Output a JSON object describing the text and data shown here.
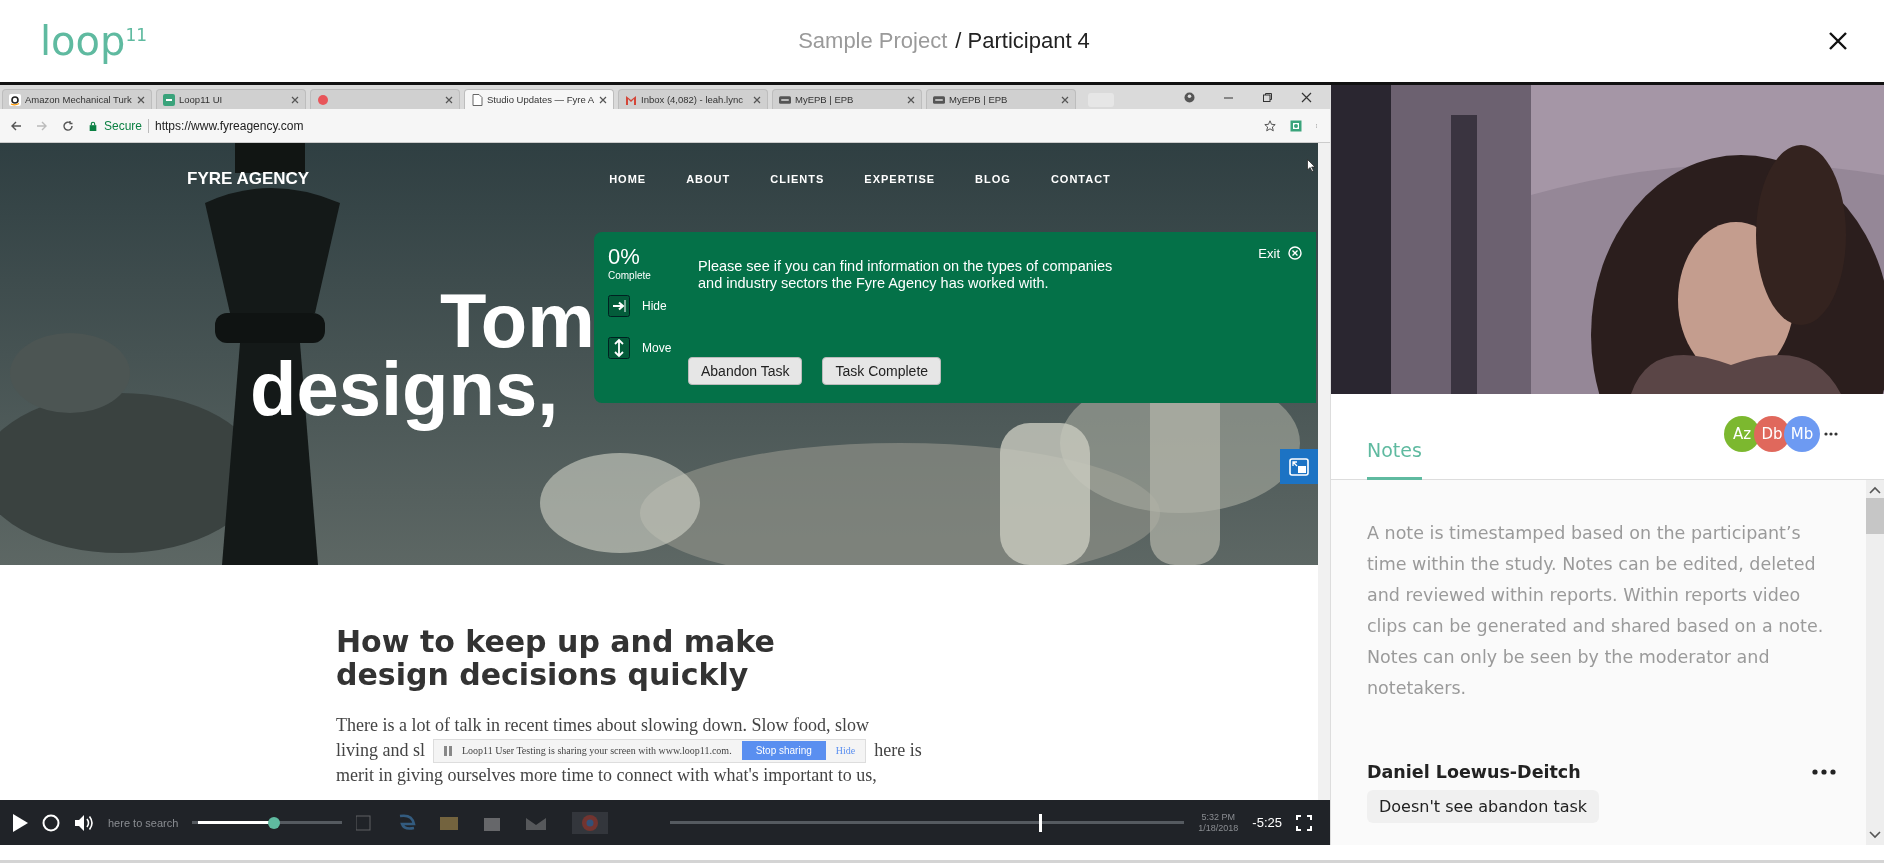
{
  "header": {
    "logo": "loop$^{11}$",
    "breadcrumb": [
      {
        "label": "Sample Project",
        "current": false
      },
      {
        "label": "/ Participant 4",
        "current": true
      }
    ]
  },
  "browser": {
    "tabs": [
      {
        "title": "Amazon Mechanical Turk",
        "kind": "letter",
        "selected": false
      },
      {
        "title": "Loop11 UI",
        "kind": "square",
        "selected": false
      },
      {
        "kind": "recording",
        "selected": false
      },
      {
        "title": "Studio Updates — Fyre A",
        "kind": "page",
        "selected": true
      },
      {
        "title": "Inbox (4,082) - leah.lync",
        "kind": "mail",
        "selected": false
      },
      {
        "title": "MyEPB | EPB",
        "kind": "logo",
        "selected": false
      },
      {
        "title": "MyEPB | EPB",
        "kind": "logo",
        "selected": false
      }
    ],
    "address": {
      "security": "Secure",
      "url": "https://www.fyreagency.com"
    }
  },
  "website": {
    "brand": "FYRE AGENCY",
    "menu": [
      "HOME",
      "ABOUT",
      "CLIENTS",
      "EXPERTISE",
      "BLOG",
      "CONTACT"
    ],
    "hero": [
      "Tom",
      "designs,"
    ],
    "article": {
      "title": "How to keep up and make design decisions quickly",
      "line_1": "There is a lot of talk in recent times about slowing down. Slow food, slow",
      "line_2_start": "living and sl",
      "line_2_end": "here is",
      "line_3": "merit in giving ourselves more time to connect with what's important to us,"
    }
  },
  "task": {
    "progress": "0%",
    "progress_label": "Complete",
    "hide": "Hide",
    "move": "Move",
    "instruction": "Please see if you can find information on the types of companies and industry sectors the Fyre Agency has worked with.",
    "exit": "Exit",
    "buttons": [
      "Abandon Task",
      "Task Complete"
    ]
  },
  "sharing_bar": {
    "message": "Loop11 User Testing is sharing your screen with www.loop11.com.",
    "stop": "Stop sharing",
    "hide": "Hide"
  },
  "player": {
    "playing": false,
    "volume": {
      "level": 0.55
    },
    "progress": {
      "level": 0.72
    },
    "remaining": "-5:25"
  },
  "taskbar": {
    "search": "here to search",
    "time": "5:32 PM",
    "date": "1/18/2018"
  },
  "notes": {
    "tabs": [
      {
        "label": "Notes",
        "selected": true
      }
    ],
    "collaborators": [
      {
        "initials": "Az",
        "color": "#7cb82f"
      },
      {
        "initials": "Db",
        "color": "#e0685c"
      },
      {
        "initials": "Mb",
        "color": "#6d9af2"
      }
    ],
    "intro": "A note is timestamped based on the participant’s time within the study. Notes can be edited, deleted and reviewed within reports. Within reports video clips can be generated and shared based on a note. Notes can only be seen by the moderator and notetakers.",
    "entries": [
      {
        "author": "Daniel Loewus-Deitch",
        "text": "Doesn't see abandon task"
      }
    ]
  }
}
